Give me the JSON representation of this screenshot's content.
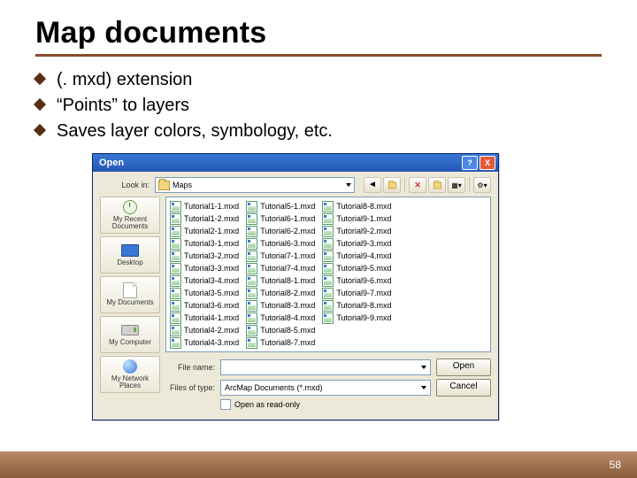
{
  "slide": {
    "title": "Map documents",
    "bullets": [
      "(. mxd) extension",
      "“Points” to layers",
      "Saves layer colors, symbology, etc."
    ],
    "page_number": "58"
  },
  "dialog": {
    "title": "Open",
    "help": "?",
    "close": "X",
    "lookin_label": "Look in:",
    "lookin_value": "Maps",
    "places": [
      "My Recent Documents",
      "Desktop",
      "My Documents",
      "My Computer",
      "My Network Places"
    ],
    "files": {
      "col1": [
        "Tutorial1-1.mxd",
        "Tutorial1-2.mxd",
        "Tutorial2-1.mxd",
        "Tutorial3-1.mxd",
        "Tutorial3-2.mxd",
        "Tutorial3-3.mxd",
        "Tutorial3-4.mxd",
        "Tutorial3-5.mxd",
        "Tutorial3-6.mxd",
        "Tutorial4-1.mxd",
        "Tutorial4-2.mxd",
        "Tutorial4-3.mxd"
      ],
      "col2": [
        "Tutorial5-1.mxd",
        "Tutorial6-1.mxd",
        "Tutorial6-2.mxd",
        "Tutorial6-3.mxd",
        "Tutorial7-1.mxd",
        "Tutorial7-4.mxd",
        "Tutorial8-1.mxd",
        "Tutorial8-2.mxd",
        "Tutorial8-3.mxd",
        "Tutorial8-4.mxd",
        "Tutorial8-5.mxd",
        "Tutorial8-7.mxd"
      ],
      "col3": [
        "Tutorial8-8.mxd",
        "Tutorial9-1.mxd",
        "Tutorial9-2.mxd",
        "Tutorial9-3.mxd",
        "Tutorial9-4.mxd",
        "Tutorial9-5.mxd",
        "Tutorial9-6.mxd",
        "Tutorial9-7.mxd",
        "Tutorial9-8.mxd",
        "Tutorial9-9.mxd"
      ]
    },
    "filename_label": "File name:",
    "filename_value": "",
    "filetype_label": "Files of type:",
    "filetype_value": "ArcMap Documents (*.mxd)",
    "checkbox_label": "Open as read-only",
    "open_btn": "Open",
    "cancel_btn": "Cancel"
  }
}
